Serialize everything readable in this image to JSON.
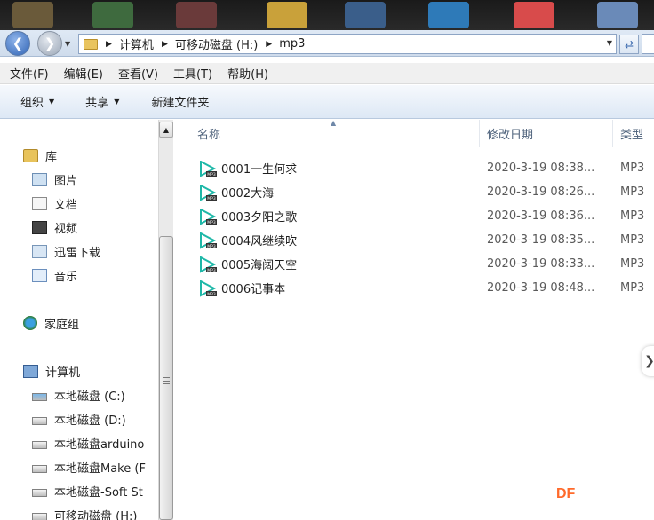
{
  "address": {
    "crumbs": [
      "计算机",
      "可移动磁盘 (H:)",
      "mp3"
    ]
  },
  "menu": [
    "文件(F)",
    "编辑(E)",
    "查看(V)",
    "工具(T)",
    "帮助(H)"
  ],
  "commands": {
    "organize": "组织",
    "share": "共享",
    "new_folder": "新建文件夹"
  },
  "nav": {
    "libraries": "库",
    "library_items": [
      "图片",
      "文档",
      "视频",
      "迅雷下载",
      "音乐"
    ],
    "homegroup": "家庭组",
    "computer": "计算机",
    "drives": [
      "本地磁盘 (C:)",
      "本地磁盘 (D:)",
      "本地磁盘arduino",
      "本地磁盘Make (F",
      "本地磁盘-Soft St",
      "可移动磁盘 (H:)"
    ]
  },
  "columns": {
    "name": "名称",
    "modified": "修改日期",
    "type": "类型"
  },
  "files": [
    {
      "name": "0001一生何求",
      "date": "2020-3-19 08:38...",
      "type": "MP3"
    },
    {
      "name": "0002大海",
      "date": "2020-3-19 08:26...",
      "type": "MP3"
    },
    {
      "name": "0003夕阳之歌",
      "date": "2020-3-19 08:36...",
      "type": "MP3"
    },
    {
      "name": "0004风继续吹",
      "date": "2020-3-19 08:35...",
      "type": "MP3"
    },
    {
      "name": "0005海阔天空",
      "date": "2020-3-19 08:33...",
      "type": "MP3"
    },
    {
      "name": "0006记事本",
      "date": "2020-3-19 08:48...",
      "type": "MP3"
    }
  ],
  "file_icon_label": "MP3",
  "watermark": "DF",
  "colors": {
    "play_icon": "#1fb8a8",
    "accent_blue": "#2f63b4"
  }
}
